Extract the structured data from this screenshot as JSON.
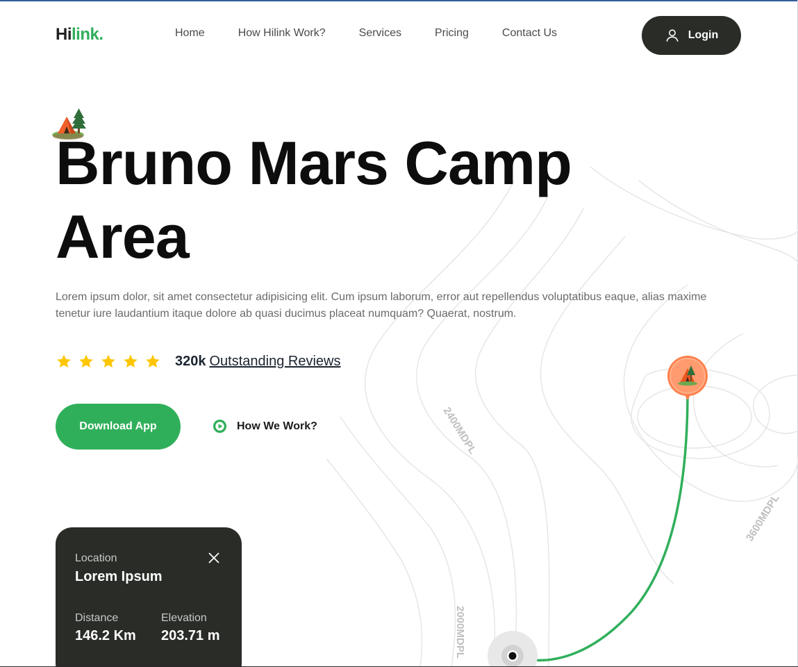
{
  "nav": {
    "logo_dark": "Hi",
    "logo_accent": "link.",
    "links": [
      "Home",
      "How Hilink Work?",
      "Services",
      "Pricing",
      "Contact Us"
    ],
    "login_label": "Login"
  },
  "hero": {
    "title_line1": "Bruno Mars Camp",
    "title_line2": "Area",
    "description": "Lorem ipsum dolor, sit amet consectetur adipisicing elit. Cum ipsum laborum, error aut repellendus voluptatibus eaque, alias maxime tenetur iure laudantium itaque dolore ab quasi ducimus placeat numquam? Quaerat, nostrum.",
    "rating_stars": 5,
    "reviews_count": "320k",
    "reviews_label": "Outstanding Reviews",
    "download_label": "Download App",
    "how_label": "How We Work?"
  },
  "map": {
    "contour_labels": [
      "2400MDPL",
      "3600MDPL",
      "2000MDPL"
    ]
  },
  "location_card": {
    "location_label": "Location",
    "location_value": "Lorem Ipsum",
    "distance_label": "Distance",
    "distance_value": "146.2 Km",
    "elevation_label": "Elevation",
    "elevation_value": "203.71 m"
  },
  "colors": {
    "accent_green": "#30af5b",
    "dark": "#292c27",
    "star_yellow": "#fec601",
    "pin_orange": "#ff814c"
  }
}
